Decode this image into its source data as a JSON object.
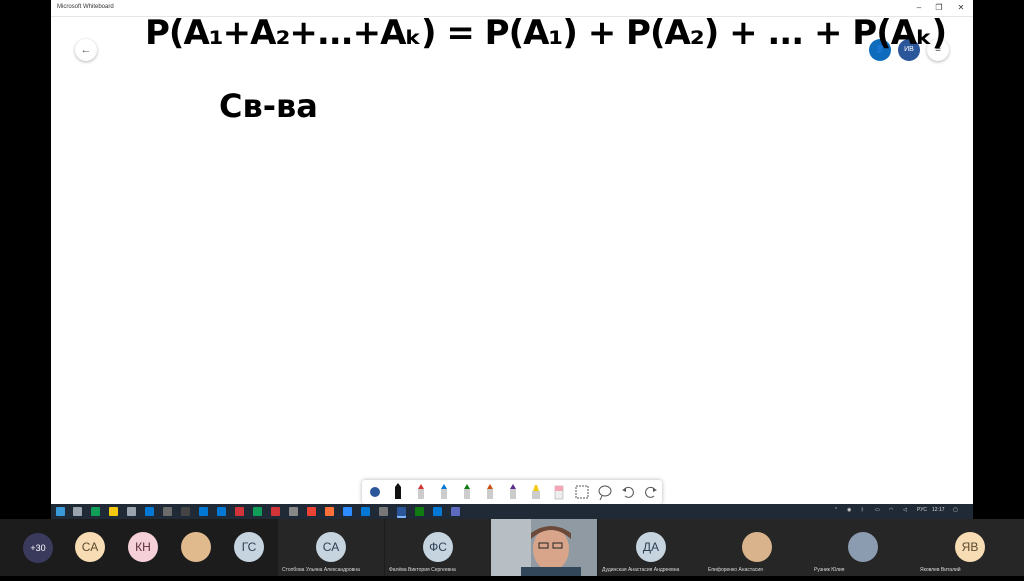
{
  "window": {
    "title": "Microsoft Whiteboard"
  },
  "header": {
    "avatar_label": "ИВ"
  },
  "board": {
    "line1": "P(A₁+A₂+...+Aₖ) = P(A₁) + P(A₂) + ... + P(Aₖ)",
    "line2": "Св-ва"
  },
  "taskbar": {
    "lang": "РУС",
    "time": "12:17"
  },
  "participants": {
    "more_count": "+30",
    "list": [
      {
        "initials": "СА",
        "color": "#f7dcb4",
        "text_color": "#5a4a2e",
        "name": ""
      },
      {
        "initials": "КН",
        "color": "#f6d0d8",
        "text_color": "#5a2e3a",
        "name": ""
      },
      {
        "initials": "",
        "color": "#e0b98c",
        "text_color": "#fff",
        "name": ""
      },
      {
        "initials": "ГС",
        "color": "#c6d4e0",
        "text_color": "#2e3f52",
        "name": ""
      },
      {
        "initials": "СА",
        "color": "#c6d4e0",
        "text_color": "#2e3f52",
        "name": "Столбова Ульяна Александровна"
      },
      {
        "initials": "ФС",
        "color": "#c6d4e0",
        "text_color": "#2e3f52",
        "name": "Фалёва Виктория Сергеевна"
      },
      {
        "initials": "ДА",
        "color": "#c6d4e0",
        "text_color": "#2e3f52",
        "name": "Дудинская Анастасия Андреевна"
      },
      {
        "initials": "",
        "color": "#d9b38c",
        "text_color": "#fff",
        "name": "Епифоренко Анастасия"
      },
      {
        "initials": "",
        "color": "#8c9cb0",
        "text_color": "#fff",
        "name": "Рузник Юлия"
      },
      {
        "initials": "ЯВ",
        "color": "#f7dcb4",
        "text_color": "#5a4a2e",
        "name": "Яковлев Виталий"
      }
    ]
  },
  "colors": {
    "accent_blue": "#2b579a",
    "active_user": "#0f6cbd"
  }
}
